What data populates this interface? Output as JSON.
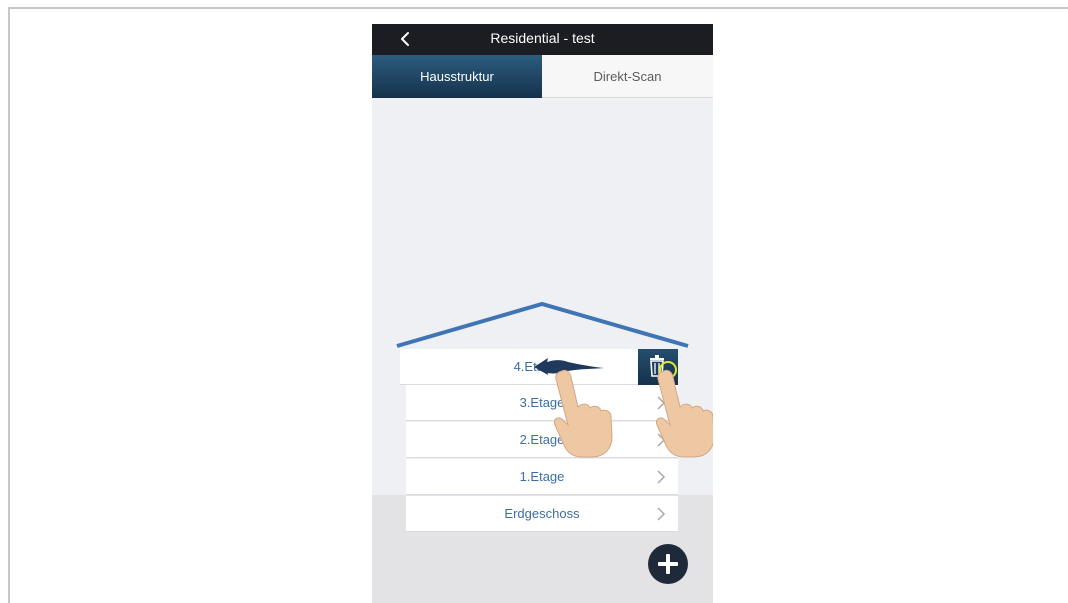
{
  "header": {
    "title": "Residential - test",
    "back_icon": "chevron-left-icon"
  },
  "tabs": [
    {
      "label": "Hausstruktur",
      "active": true
    },
    {
      "label": "Direkt-Scan",
      "active": false
    }
  ],
  "floors": [
    {
      "label": "4.Etage",
      "swiped": true
    },
    {
      "label": "3.Etage",
      "swiped": false
    },
    {
      "label": "2.Etage",
      "swiped": false
    },
    {
      "label": "1.Etage",
      "swiped": false
    },
    {
      "label": "Erdgeschoss",
      "swiped": false
    }
  ],
  "delete_action": {
    "icon": "trash-icon"
  },
  "add_button": {
    "icon": "plus-icon"
  },
  "colors": {
    "title_bar": "#1b1d22",
    "tab_active": "#15314b",
    "floor_text": "#3b6fa4",
    "roof": "#3f74b5",
    "highlight": "#e5e824"
  }
}
